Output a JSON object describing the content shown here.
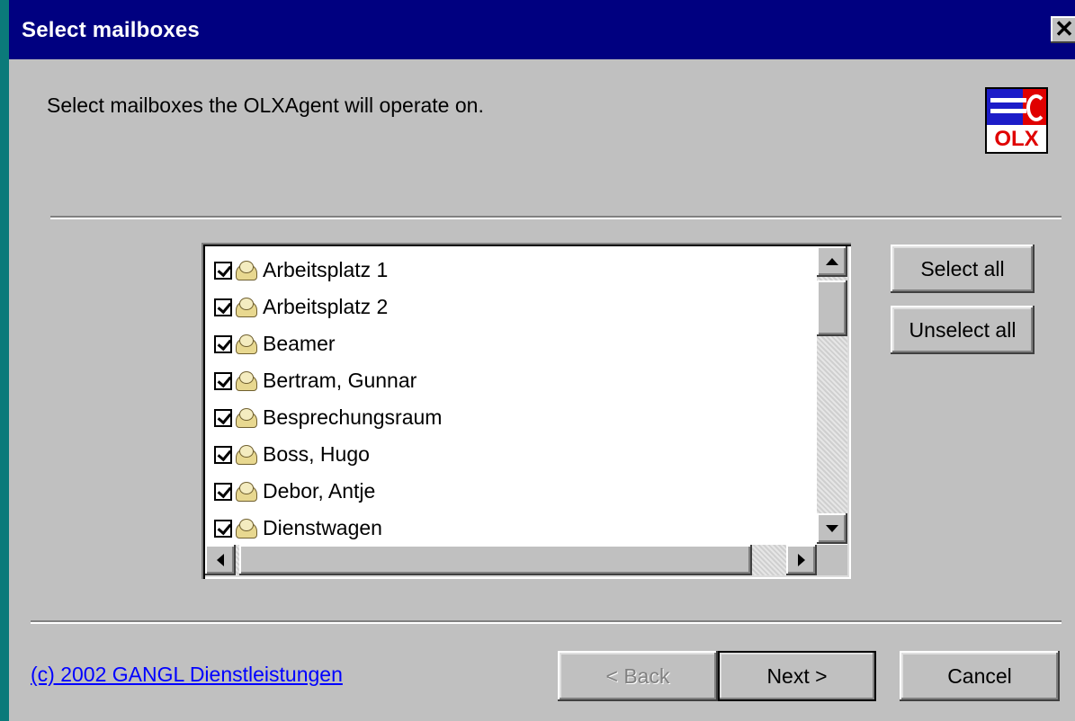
{
  "window": {
    "title": "Select mailboxes",
    "close_glyph": "✕"
  },
  "header": {
    "description": "Select mailboxes the OLXAgent will operate on.",
    "logo_text": "OLX"
  },
  "mailbox_list": {
    "items": [
      {
        "label": "Arbeitsplatz 1",
        "checked": true
      },
      {
        "label": "Arbeitsplatz 2",
        "checked": true
      },
      {
        "label": "Beamer",
        "checked": true
      },
      {
        "label": "Bertram, Gunnar",
        "checked": true
      },
      {
        "label": "Besprechungsraum",
        "checked": true
      },
      {
        "label": "Boss, Hugo",
        "checked": true
      },
      {
        "label": "Debor, Antje",
        "checked": true
      },
      {
        "label": "Dienstwagen",
        "checked": true
      }
    ]
  },
  "side_buttons": {
    "select_all": "Select all",
    "unselect_all": "Unselect all"
  },
  "footer": {
    "copyright_link": "(c) 2002 GANGL Dienstleistungen",
    "back": "< Back",
    "next": "Next >",
    "cancel": "Cancel"
  },
  "icons": {
    "mailbox": "mailbox-icon",
    "checkbox": "checkbox-checked-icon",
    "scroll_up": "arrow-up-icon",
    "scroll_down": "arrow-down-icon",
    "scroll_left": "arrow-left-icon",
    "scroll_right": "arrow-right-icon"
  },
  "colors": {
    "titlebar": "#000080",
    "dialog": "#c0c0c0",
    "link": "#0000ff",
    "logo_red": "#e00000",
    "logo_blue": "#1c1cc8"
  }
}
